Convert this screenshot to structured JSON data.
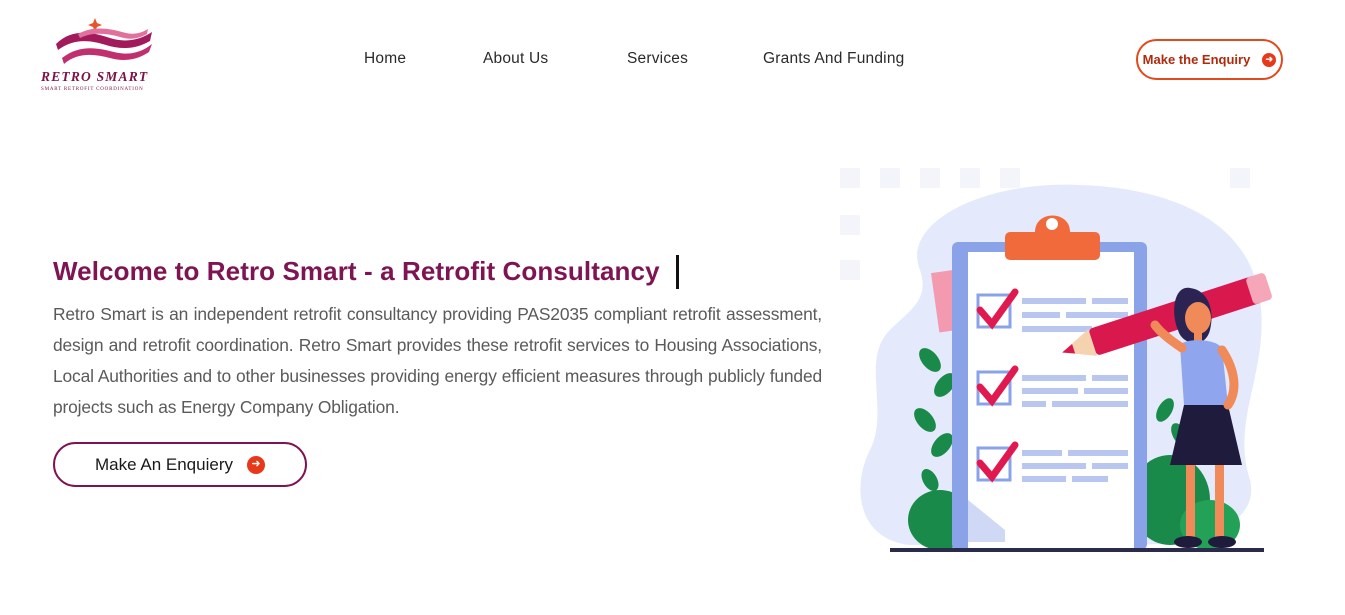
{
  "brand": {
    "name": "RETRO SMART",
    "tagline": "SMART RETROFIT COORDINATION",
    "colors": {
      "primary": "#7e1451",
      "accent": "#e24a1c"
    }
  },
  "nav": {
    "items": [
      {
        "label": "Home"
      },
      {
        "label": "About Us"
      },
      {
        "label": "Services"
      },
      {
        "label": "Grants And Funding"
      }
    ]
  },
  "header": {
    "cta_label": "Make the Enquiry",
    "cta_icon": "arrow-right-circle-icon"
  },
  "hero": {
    "title": "Welcome to Retro Smart - a Retrofit Consultancy",
    "description": "Retro Smart is an independent retrofit consultancy providing PAS2035 compliant retrofit assessment, design and retrofit coordination. Retro Smart provides these retrofit services to Housing Associations, Local Authorities and to other businesses providing energy efficient measures through publicly funded projects such as Energy Company Obligation.",
    "cta_label": "Make An Enquiery",
    "cta_icon": "arrow-right-circle-icon",
    "illustration": "checklist-clipboard-woman-pencil-illustration"
  }
}
